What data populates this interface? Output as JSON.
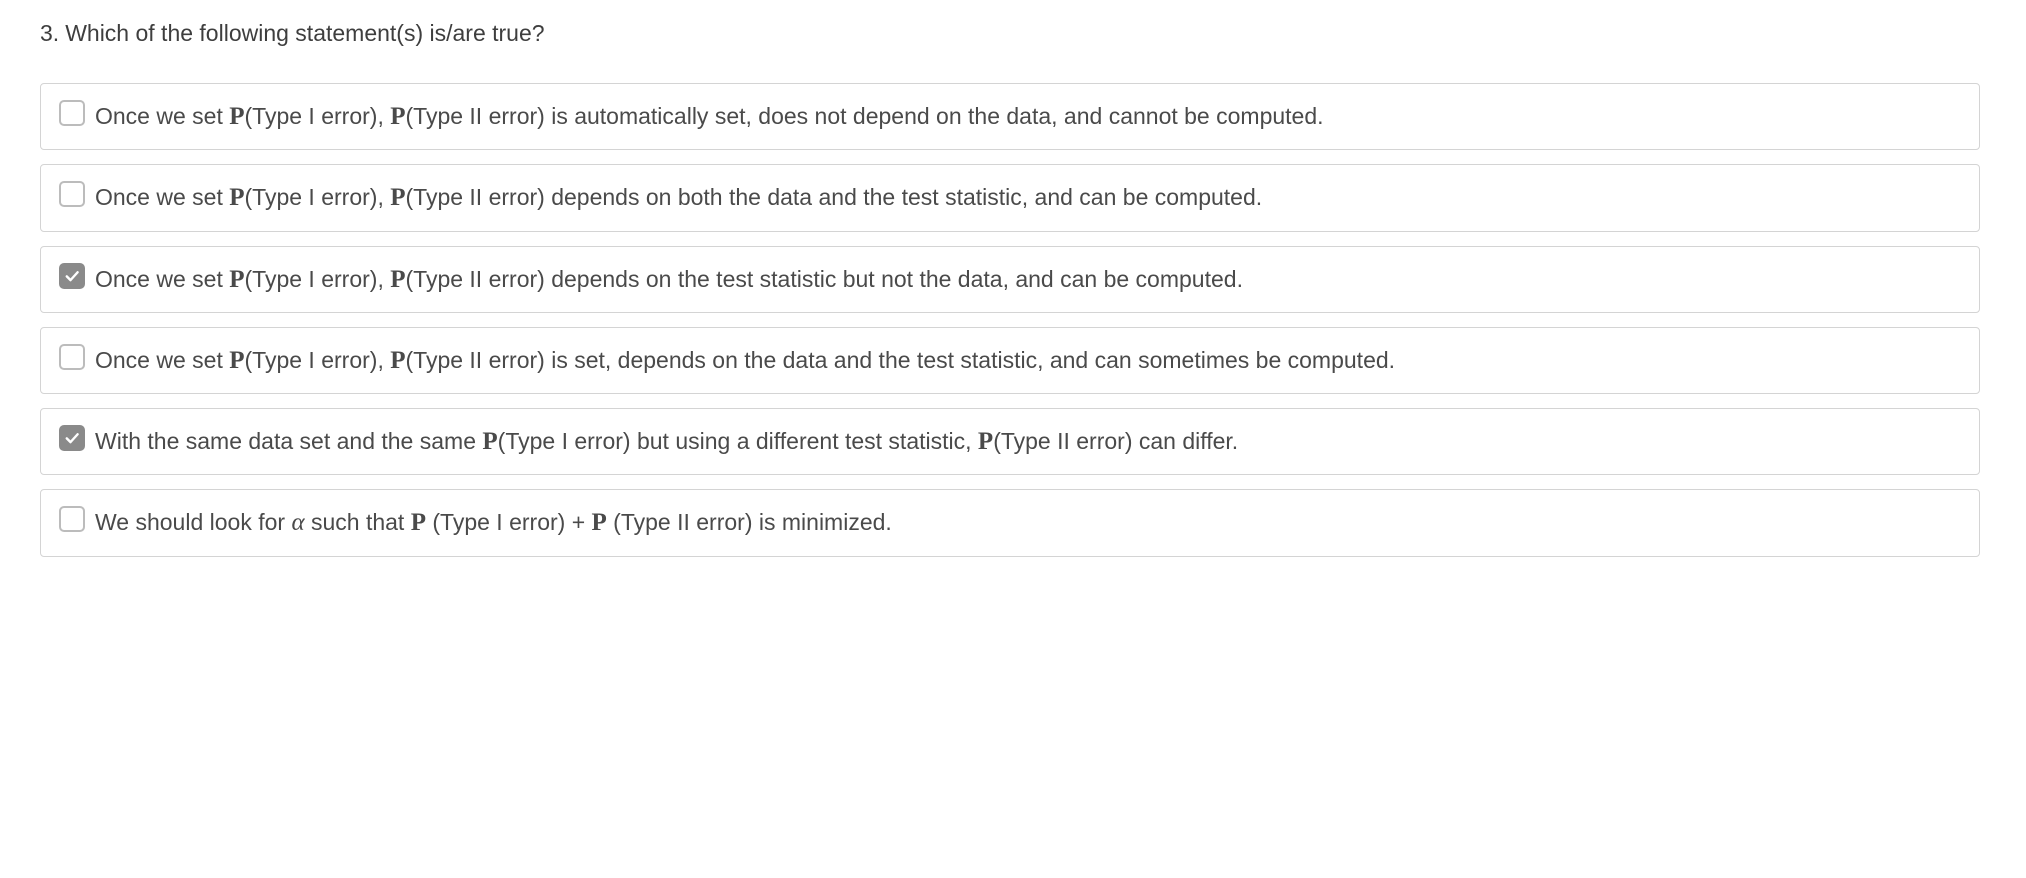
{
  "question": {
    "number": "3.",
    "text": "Which of the following statement(s) is/are true?"
  },
  "P": "P",
  "type1": "(Type I error)",
  "type2": "(Type II error)",
  "alpha": "α",
  "choices": [
    {
      "checked": false,
      "parts": {
        "a": "Once we set ",
        "b": ", ",
        "c": " is automatically set, does not depend on the data, and cannot be computed."
      }
    },
    {
      "checked": false,
      "parts": {
        "a": "Once we set ",
        "b": ", ",
        "c": " depends on both the data and the test statistic, and can be computed."
      }
    },
    {
      "checked": true,
      "parts": {
        "a": "Once we set ",
        "b": ", ",
        "c": " depends on the test statistic but not the data, and can be computed."
      }
    },
    {
      "checked": false,
      "parts": {
        "a": "Once we set ",
        "b": ", ",
        "c": " is set, depends on the data and the test statistic, and can sometimes be computed."
      }
    },
    {
      "checked": true,
      "parts": {
        "a": "With the same data set and the same ",
        "b": " but using a different test statistic, ",
        "c": " can differ."
      }
    },
    {
      "checked": false,
      "parts": {
        "a": "We should look for ",
        "b": " such that ",
        "c": " (Type I error) + ",
        "d": " (Type II error) is minimized."
      }
    }
  ]
}
